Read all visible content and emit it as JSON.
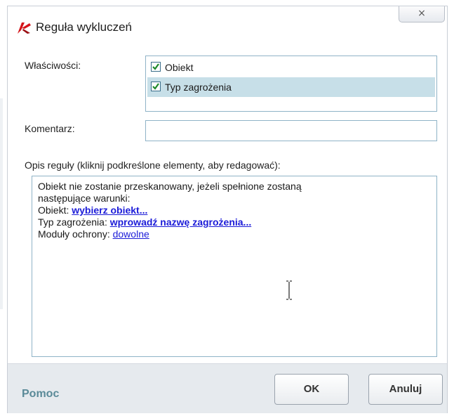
{
  "window": {
    "title": "Reguła wykluczeń",
    "close_glyph": "×"
  },
  "properties": {
    "label": "Właściwości:",
    "items": [
      {
        "label": "Obiekt",
        "checked": true,
        "selected": false
      },
      {
        "label": "Typ zagrożenia",
        "checked": true,
        "selected": true
      }
    ]
  },
  "comment": {
    "label": "Komentarz:",
    "value": ""
  },
  "description": {
    "label": "Opis reguły (kliknij podkreślone elementy, aby redagować):",
    "line1": "Obiekt nie zostanie przeskanowany, jeżeli spełnione zostaną",
    "line2": "następujące warunki:",
    "object_label": "Obiekt: ",
    "object_link": "wybierz obiekt...",
    "threat_label": "Typ zagrożenia: ",
    "threat_link": "wprowadź nazwę zagrożenia...",
    "modules_label": "Moduły ochrony: ",
    "modules_link": "dowolne"
  },
  "footer": {
    "help": "Pomoc",
    "ok": "OK",
    "cancel": "Anuluj"
  },
  "colors": {
    "accent": "#1c1cd8",
    "selection": "#c7dfe8",
    "help_text": "#5a8a98"
  }
}
